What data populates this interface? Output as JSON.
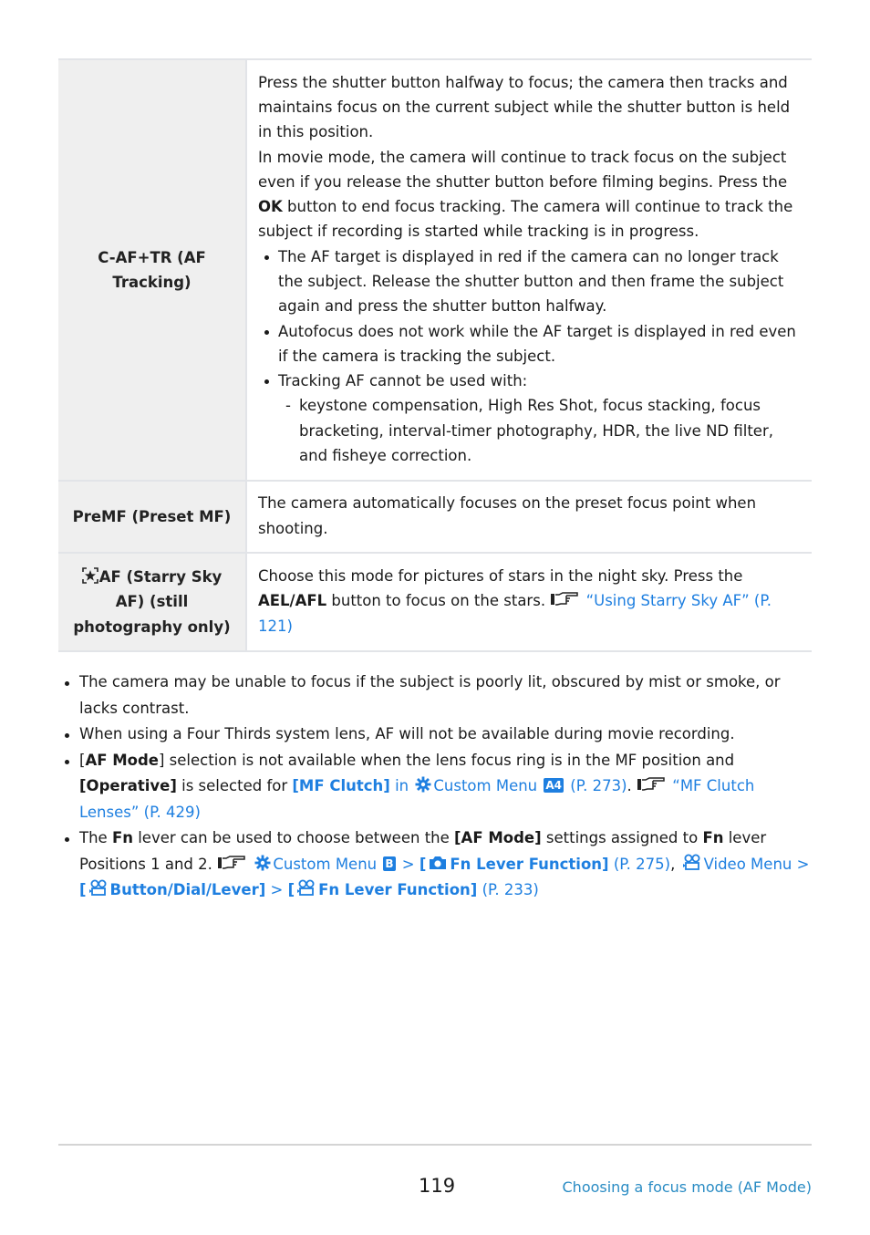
{
  "table": {
    "rows": [
      {
        "key": "C-AF+TR (AF Tracking)",
        "intro": "Press the shutter button halfway to focus; the camera then tracks and maintains focus on the current subject while the shutter button is held in this position.",
        "movie_pre": "In movie mode, the camera will continue to track focus on the subject even if you release the shutter button before filming begins. Press the ",
        "movie_ok": "OK",
        "movie_post": " button to end focus tracking. The camera will continue to track the subject if recording is started while tracking is in progress.",
        "bullets": [
          "The AF target is displayed in red if the camera can no longer track the subject. Release the shutter button and then frame the subject again and press the shutter button halfway.",
          "Autofocus does not work while the AF target is displayed in red even if the camera is tracking the subject.",
          "Tracking AF cannot be used with:"
        ],
        "sub_items": [
          "keystone compensation, High Res Shot, focus stacking, focus bracketing, interval-timer photography, HDR, the live ND filter, and fisheye correction."
        ]
      },
      {
        "key": "PreMF (Preset MF)",
        "text": "The camera automatically focuses on the preset focus point when shooting."
      },
      {
        "key_icon": "starry-sky-af-icon",
        "key": "AF (Starry Sky AF) (still photography only)",
        "text_pre": "Choose this mode for pictures of stars in the night sky. Press the ",
        "text_bold": "AEL/AFL",
        "text_post": " button to focus on the stars. ",
        "link": "“Using Starry Sky AF” (P. 121)"
      }
    ]
  },
  "notes": {
    "n1": "The camera may be unable to focus if the subject is poorly lit, obscured by mist or smoke, or lacks contrast.",
    "n2": "When using a Four Thirds system lens, AF will not be available during movie recording.",
    "n3": {
      "open": "[",
      "bold1": "AF Mode",
      "mid1": "] selection is not available when the lens focus ring is in the MF position and ",
      "bold2": "[Operative]",
      "mid2": " is selected for ",
      "link_mf_clutch": "[MF Clutch]",
      "link_in": " in ",
      "link_custom_menu": "Custom Menu",
      "badge": "A4",
      "link_page": " (P. 273)",
      "dot": ". ",
      "ref_link": "“MF Clutch Lenses” (P. 429)"
    },
    "n4": {
      "t1": "The ",
      "fn1": "Fn",
      "t2": " lever can be used to choose between the ",
      "afmode": "[AF Mode]",
      "t3": " settings assigned to ",
      "fn2": "Fn",
      "t4": " lever Positions 1 and 2. ",
      "custom_menu": "Custom Menu",
      "badge": "B",
      "gt1": " > ",
      "fn_lever_func_open": "[",
      "fn_lever_func": "Fn Lever Function]",
      "p275": " (P. 275)",
      "comma": ", ",
      "video_menu": "Video Menu >",
      "btn_open": "[",
      "btn_dial": "Button/Dial/Lever]",
      "gt2": " > ",
      "fn2_open": "[",
      "fn_lever_func2": "Fn Lever Function]",
      "p233": " (P. 233)"
    }
  },
  "footer": {
    "page_number": "119",
    "section_link": "Choosing a focus mode (AF Mode)"
  }
}
